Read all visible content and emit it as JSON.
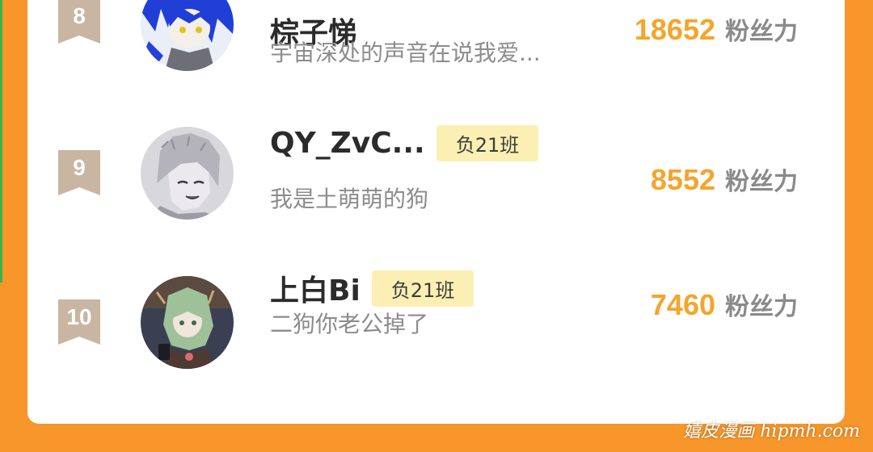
{
  "leaderboard": {
    "rows": [
      {
        "rank": "8",
        "name": "棕子悌",
        "class_badge": "",
        "bio": "宇宙深处的声音在说我爱...",
        "fans_value": "18652",
        "fans_unit": "粉丝力",
        "avatar": "blue-hair-anime-avatar"
      },
      {
        "rank": "9",
        "name": "QY_ZvC...",
        "class_badge": "负21班",
        "bio": "我是土萌萌的狗",
        "fans_value": "8552",
        "fans_unit": "粉丝力",
        "avatar": "gray-sketch-avatar"
      },
      {
        "rank": "10",
        "name": "上白Bi",
        "class_badge": "负21班",
        "bio": "二狗你老公掉了",
        "fans_value": "7460",
        "fans_unit": "粉丝力",
        "avatar": "green-hair-anime-avatar"
      }
    ]
  },
  "watermark": "嬉皮漫画 hipmh.com",
  "colors": {
    "background": "#f7962a",
    "rank_badge": "#c8b6a2",
    "fans_value": "#f4a52c",
    "class_badge_bg": "#fcefb3"
  }
}
